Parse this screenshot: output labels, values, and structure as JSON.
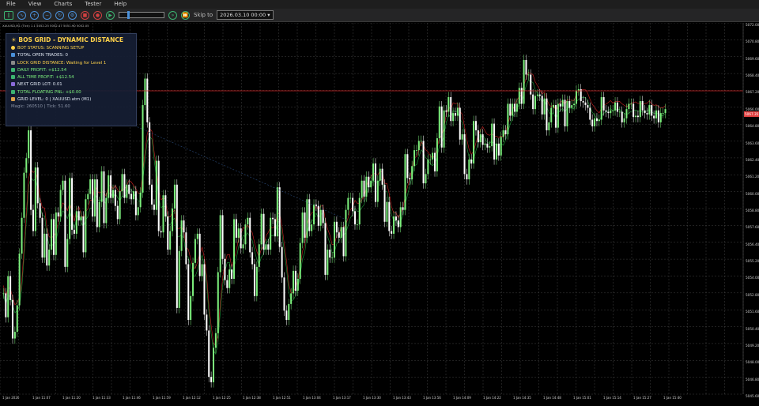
{
  "menu": [
    "File",
    "View",
    "Charts",
    "Tester",
    "Help"
  ],
  "toolbar": {
    "skip_label": "Skip to",
    "date_value": "2026.03.10 00:00"
  },
  "chart_header": "XAUUSD,M1 (Tick) 1.1  5052.25  5052.47  5051.90  5052.05",
  "panel": {
    "title": "BOS GRID - DYNAMIC DISTANCE",
    "status": "BOT STATUS: SCANNING SETUP",
    "open_trades": "TOTAL OPEN TRADES: 0",
    "lock_distance": "LOCK GRID DISTANCE: Waiting for Level 1",
    "daily_profit": "DAILY PROFIT: +$12.54",
    "all_time_profit": "ALL TIME PROFIT: +$12.54",
    "next_lot": "NEXT GRID LOT: 0.01",
    "floating_pnl": "TOTAL FLOATING PNL: +$0.00",
    "grid_level": "GRID LEVEL: 0 | XAUUSD.atm (M1)",
    "magic": "Magic: 260510 | Tick: 51.60"
  },
  "prices": [
    "5072.00",
    "5070.80",
    "5069.60",
    "5068.40",
    "5067.20",
    "5066.00",
    "5064.80",
    "5063.60",
    "5062.40",
    "5061.20",
    "5060.00",
    "5058.80",
    "5057.60",
    "5056.40",
    "5055.20",
    "5054.00",
    "5052.80",
    "5051.60",
    "5050.40",
    "5049.20",
    "5048.00",
    "5046.80",
    "5045.60"
  ],
  "current_price": "5067.35",
  "times": [
    "1 Jan 2026",
    "1 Jan 11:07",
    "1 Jan 11:20",
    "1 Jan 11:33",
    "1 Jan 11:46",
    "1 Jan 11:59",
    "1 Jan 12:12",
    "1 Jan 12:25",
    "1 Jan 12:38",
    "1 Jan 12:51",
    "1 Jan 13:04",
    "1 Jan 13:17",
    "1 Jan 13:30",
    "1 Jan 13:43",
    "1 Jan 13:56",
    "1 Jan 14:09",
    "1 Jan 14:22",
    "1 Jan 14:35",
    "1 Jan 14:48",
    "1 Jan 15:01",
    "1 Jan 15:14",
    "1 Jan 15:27",
    "1 Jan 15:40"
  ],
  "colors": {
    "bull": "#7cf07c",
    "bear": "#ffffff",
    "red_line": "#cc2222",
    "ma": "#1f9d3a",
    "grid": "#505050",
    "panel_title": "#ffd24a"
  },
  "chart_data": {
    "type": "candlestick",
    "ylim": [
      5045,
      5073
    ],
    "closes": [
      5052.6,
      5050.8,
      5053.9,
      5052.1,
      5049.2,
      5049.7,
      5051.7,
      5055.6,
      5058.3,
      5061.7,
      5062.8,
      5064.9,
      5058.9,
      5057.3,
      5062.1,
      5059.4,
      5058.3,
      5055.3,
      5057.1,
      5054.7,
      5055.9,
      5058.2,
      5055.5,
      5058.7,
      5058.4,
      5060.4,
      5061.1,
      5054.6,
      5056.7,
      5061.3,
      5057.4,
      5057.1,
      5058.8,
      5058.1,
      5058.4,
      5055.7,
      5059.7,
      5060.1,
      5061.2,
      5058.4,
      5061.2,
      5057.6,
      5059.5,
      5061.8,
      5057.9,
      5059.8,
      5061.5,
      5059.8,
      5060.4,
      5059.2,
      5058.2,
      5060.3,
      5061.6,
      5059.8,
      5060.8,
      5060.1,
      5059.7,
      5060.3,
      5058.5,
      5059.1,
      5060.2,
      5066.8,
      5068.8,
      5065.5,
      5060.8,
      5059.3,
      5058.9,
      5062.6,
      5057.3,
      5057.2,
      5060.0,
      5058.4,
      5055.9,
      5057.3,
      5059.0,
      5060.8,
      5051.5,
      5055.8,
      5058.1,
      5057.2,
      5054.8,
      5050.6,
      5052.4,
      5054.9,
      5056.7,
      5057.1,
      5053.9,
      5054.8,
      5051.0,
      5049.8,
      5046.3,
      5045.9,
      5048.5,
      5049.6,
      5054.2,
      5058.5,
      5055.2,
      5053.6,
      5053.0,
      5054.4,
      5053.7,
      5058.2,
      5056.8,
      5057.5,
      5056.0,
      5056.3,
      5057.8,
      5058.3,
      5055.7,
      5054.8,
      5052.4,
      5054.6,
      5056.3,
      5058.6,
      5055.9,
      5056.3,
      5055.9,
      5058.3,
      5058.2,
      5056.9,
      5060.6,
      5056.1,
      5053.8,
      5051.3,
      5050.6,
      5051.8,
      5052.6,
      5054.3,
      5052.8,
      5053.7,
      5056.4,
      5058.7,
      5056.8,
      5059.7,
      5057.3,
      5057.8,
      5059.3,
      5059.2,
      5057.7,
      5058.9,
      5057.9,
      5054.0,
      5055.9,
      5055.3,
      5055.3,
      5058.0,
      5057.2,
      5056.8,
      5057.6,
      5055.4,
      5058.9,
      5059.8,
      5059.8,
      5058.8,
      5057.8,
      5057.8,
      5059.8,
      5061.1,
      5059.9,
      5061.4,
      5060.6,
      5061.1,
      5062.4,
      5059.5,
      5061.1,
      5062.0,
      5060.8,
      5058.0,
      5059.5,
      5057.3,
      5057.1,
      5058.4,
      5058.1,
      5057.6,
      5059.1,
      5058.9,
      5063.1,
      5061.3,
      5061.2,
      5062.2,
      5063.4,
      5063.4,
      5064.1,
      5064.1,
      5060.9,
      5061.6,
      5062.7,
      5062.7,
      5063.2,
      5061.8,
      5064.3,
      5066.7,
      5063.6,
      5066.4,
      5066.3,
      5067.4,
      5065.6,
      5066.2,
      5066.0,
      5066.6,
      5064.2,
      5064.6,
      5061.6,
      5061.2,
      5062.7,
      5062.4,
      5065.6,
      5064.9,
      5064.0,
      5064.6,
      5063.8,
      5063.9,
      5063.6,
      5063.7,
      5065.4,
      5062.7,
      5063.9,
      5063.0,
      5064.4,
      5064.9,
      5064.6,
      5066.9,
      5066.0,
      5066.9,
      5066.3,
      5066.9,
      5068.1,
      5066.9,
      5070.2,
      5069.1,
      5069.1,
      5067.6,
      5066.5,
      5067.5,
      5067.6,
      5067.5,
      5066.1,
      5067.3,
      5064.9,
      5065.5,
      5066.6,
      5066.8,
      5065.1,
      5066.9,
      5066.7,
      5067.2,
      5065.2,
      5067.1,
      5066.6,
      5066.8,
      5066.9,
      5067.9,
      5068.0,
      5067.1,
      5067.0,
      5066.8,
      5066.6,
      5065.7,
      5065.2,
      5065.8,
      5065.6,
      5065.7,
      5067.4,
      5066.4,
      5066.3,
      5066.2,
      5066.4,
      5066.4,
      5067.0,
      5066.3,
      5066.3,
      5065.5,
      5065.8,
      5066.5,
      5066.9,
      5066.9,
      5065.9,
      5066.0,
      5065.9,
      5067.1,
      5066.4,
      5066.2,
      5066.1,
      5066.8,
      5066.0,
      5065.8,
      5066.4,
      5065.5,
      5066.2,
      5066.2,
      5066.5
    ]
  }
}
